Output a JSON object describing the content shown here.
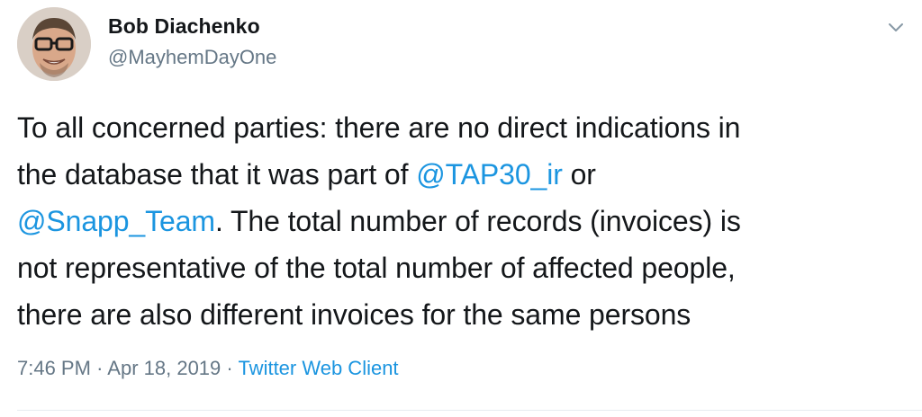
{
  "author": {
    "name": "Bob Diachenko",
    "handle": "@MayhemDayOne",
    "avatar_icon": "user-avatar"
  },
  "menu": {
    "icon": "chevron-down-icon"
  },
  "tweet": {
    "lines": [
      [
        {
          "text": "To all concerned parties: there are no direct indications in",
          "type": "text"
        }
      ],
      [
        {
          "text": "the database that it was part of ",
          "type": "text"
        },
        {
          "text": "@TAP30_ir",
          "type": "mention"
        },
        {
          "text": " or",
          "type": "text"
        }
      ],
      [
        {
          "text": "@Snapp_Team",
          "type": "mention"
        },
        {
          "text": ". The total number of records (invoices) is",
          "type": "text"
        }
      ],
      [
        {
          "text": "not representative of the total number of affected people,",
          "type": "text"
        }
      ],
      [
        {
          "text": "there are also different invoices for the same persons",
          "type": "text"
        }
      ]
    ]
  },
  "meta": {
    "time": "7:46 PM",
    "separator": "·",
    "date": "Apr 18, 2019",
    "source": "Twitter Web Client"
  },
  "colors": {
    "link": "#1b95e0",
    "secondary": "#657786",
    "text": "#14171a"
  }
}
